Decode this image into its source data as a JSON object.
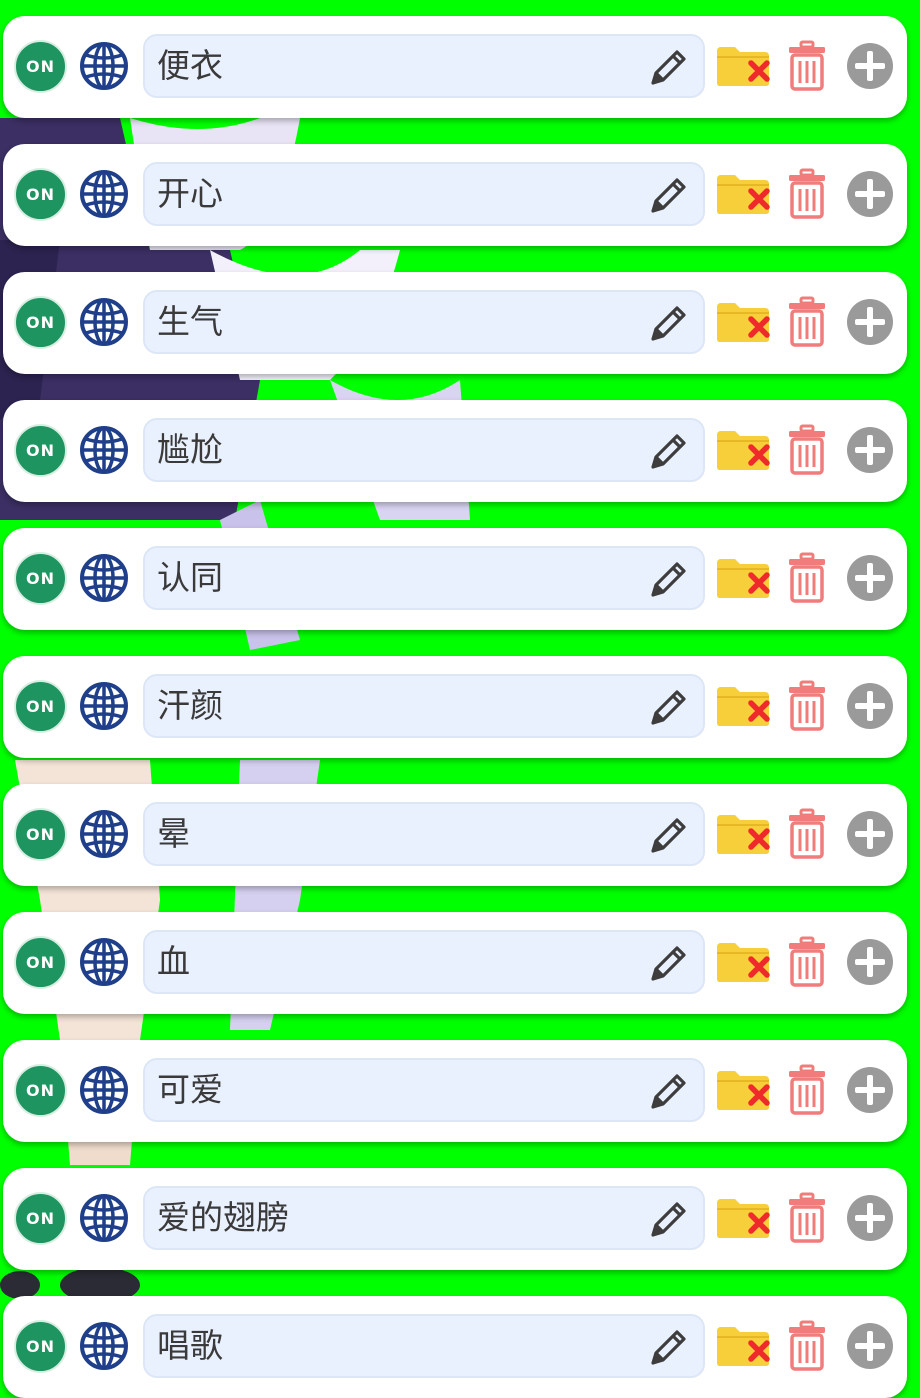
{
  "toggle_label": "ON",
  "colors": {
    "background": "#00ff00",
    "toggle_on": "#1e9461",
    "globe": "#1f3f8a",
    "field_bg": "#eaf1fe",
    "folder": "#f7cf3b",
    "folder_x": "#ee2a2a",
    "trash": "#f07c7c",
    "add": "#9a9a9a",
    "edit": "#3d3d3d"
  },
  "icons": {
    "toggle": "on-toggle",
    "globe": "globe-icon",
    "edit": "pencil-icon",
    "folder": "folder-remove-icon",
    "trash": "trash-icon",
    "add": "plus-circle-icon"
  },
  "items": [
    {
      "name": "便衣",
      "enabled": true
    },
    {
      "name": "开心",
      "enabled": true
    },
    {
      "name": "生气",
      "enabled": true
    },
    {
      "name": "尴尬",
      "enabled": true
    },
    {
      "name": "认同",
      "enabled": true
    },
    {
      "name": "汗颜",
      "enabled": true
    },
    {
      "name": "晕",
      "enabled": true
    },
    {
      "name": "血",
      "enabled": true
    },
    {
      "name": "可爱",
      "enabled": true
    },
    {
      "name": "爱的翅膀",
      "enabled": true
    },
    {
      "name": "唱歌",
      "enabled": true
    }
  ]
}
